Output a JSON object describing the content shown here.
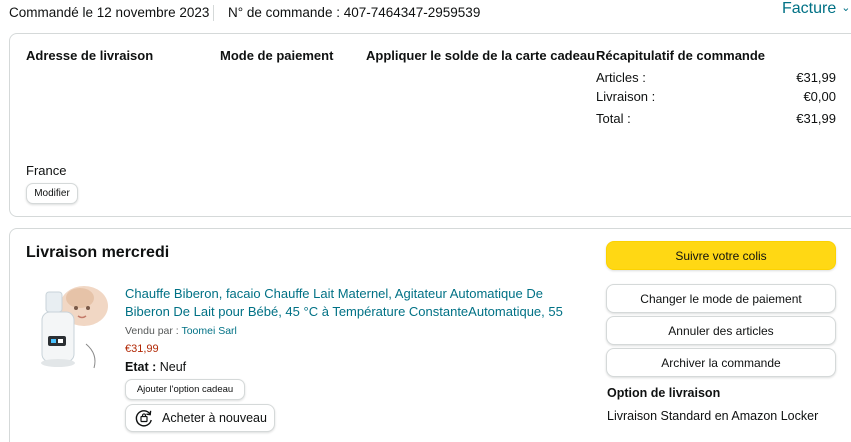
{
  "header": {
    "order_date": "Commandé le 12 novembre 2023",
    "order_number": "N° de commande : 407-7464347-2959539",
    "invoice_label": "Facture",
    "invoice_caret": "⌄"
  },
  "details": {
    "shipping_address_label": "Adresse de livraison",
    "payment_method_label": "Mode de paiement",
    "gift_card_label": "Appliquer le solde de la carte cadeau",
    "summary_label": "Récapitulatif de commande",
    "summary": [
      {
        "label": "Articles :",
        "value": "€31,99"
      },
      {
        "label": "Livraison :",
        "value": "€0,00"
      },
      {
        "label": "Total :",
        "value": "€31,99"
      }
    ],
    "country": "France",
    "modify_label": "Modifier"
  },
  "shipment": {
    "title": "Livraison mercredi",
    "product_title": "Chauffe Biberon, facaio Chauffe Lait Maternel, Agitateur Automatique De Biberon De Lait pour Bébé, 45 °C à Température ConstanteAutomatique, 55",
    "seller_prefix": "Vendu par : ",
    "seller_name": "Toomei Sarl",
    "price": "€31,99",
    "condition_label": "Etat :",
    "condition_value": "Neuf",
    "gift_option_label": "Ajouter l'option cadeau",
    "rebuy_label": "Acheter à nouveau",
    "rebuy_icon": "rebuy-icon"
  },
  "actions": {
    "track_label": "Suivre votre colis",
    "change_payment_label": "Changer le mode de paiement",
    "cancel_label": "Annuler des articles",
    "archive_label": "Archiver la commande"
  },
  "delivery_option": {
    "label": "Option de livraison",
    "value": "Livraison Standard en Amazon Locker"
  },
  "colors": {
    "link": "#007185",
    "price": "#b12704",
    "primary_button": "#ffd814",
    "border": "#d5d9d9"
  }
}
